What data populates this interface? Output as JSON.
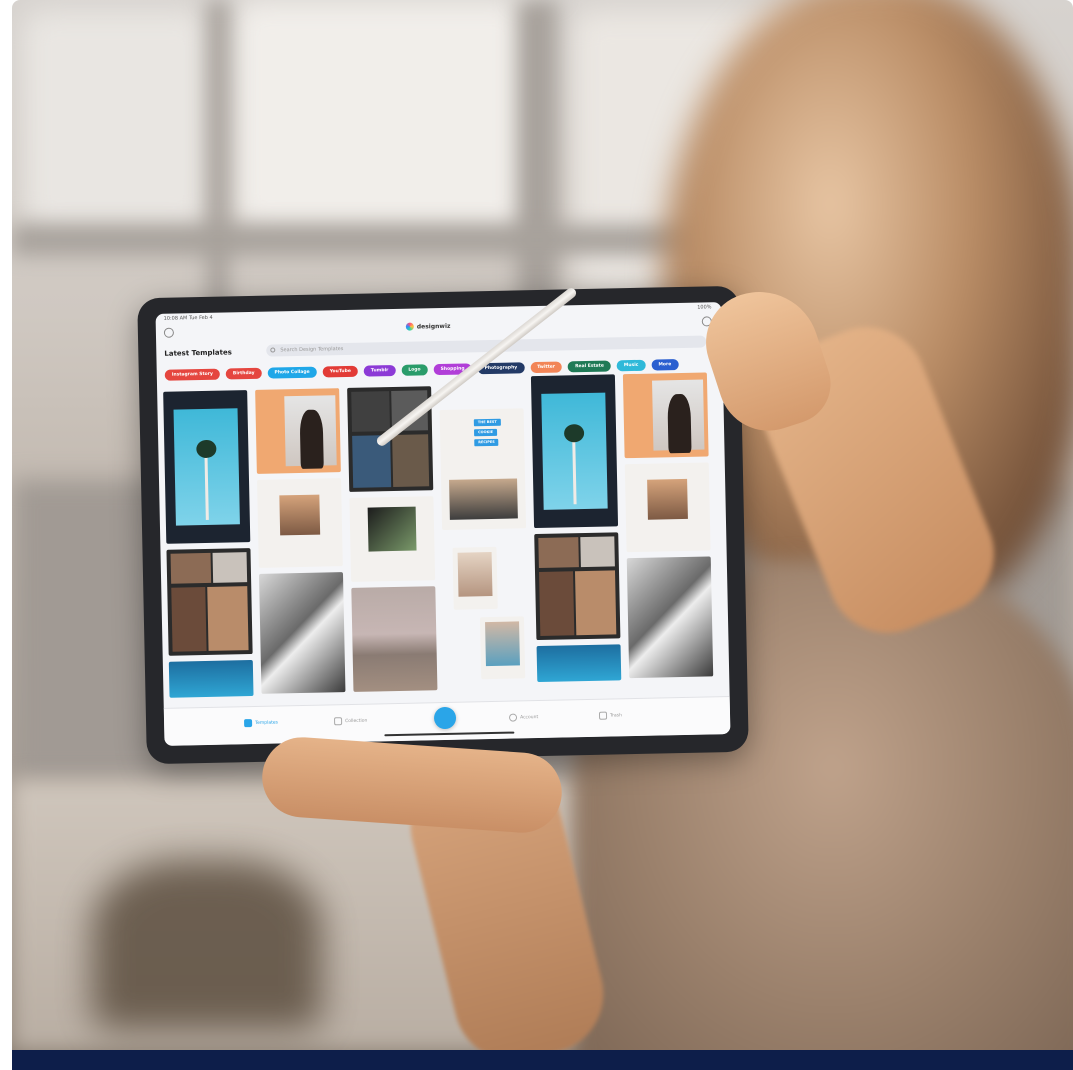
{
  "app": {
    "status_left": "10:08 AM  Tue Feb 4",
    "status_right": "100%",
    "logo_text": "designwiz",
    "section_title": "Latest Templates",
    "search_placeholder": "Search Design Templates"
  },
  "chips": [
    {
      "label": "Instagram Story",
      "color": "#e5463f"
    },
    {
      "label": "Birthday",
      "color": "#e5463f"
    },
    {
      "label": "Photo Collage",
      "color": "#1fa7e8"
    },
    {
      "label": "YouTube",
      "color": "#e23b36"
    },
    {
      "label": "Tumblr",
      "color": "#8c3ad6"
    },
    {
      "label": "Logo",
      "color": "#2a9c6a"
    },
    {
      "label": "Shopping",
      "color": "#b13ed8"
    },
    {
      "label": "Photography",
      "color": "#233a66"
    },
    {
      "label": "Twitter",
      "color": "#f28557"
    },
    {
      "label": "Real Estate",
      "color": "#1f7a56"
    },
    {
      "label": "Music",
      "color": "#2fb9d9"
    },
    {
      "label": "More",
      "color": "#2a5fd0"
    }
  ],
  "template_tags": [
    "THE BEST",
    "COOKIE",
    "RECIPES"
  ],
  "bottom_nav": [
    {
      "label": "Templates",
      "icon": "templates-icon",
      "active": true
    },
    {
      "label": "Collection",
      "icon": "bookmark-icon",
      "active": false
    },
    {
      "label": "Account",
      "icon": "account-icon",
      "active": false
    },
    {
      "label": "Trash",
      "icon": "trash-icon",
      "active": false
    }
  ],
  "colors": {
    "accent": "#2aa5e8",
    "bottom_band": "#0d1e4a"
  }
}
